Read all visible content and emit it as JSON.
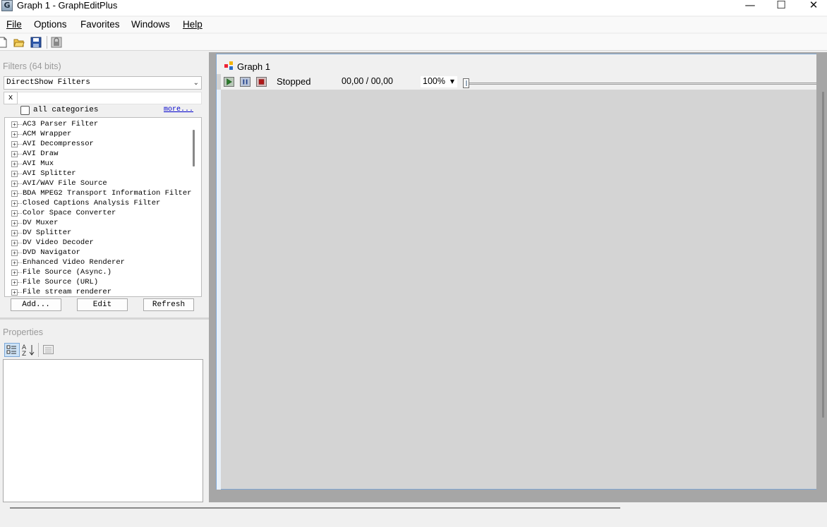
{
  "window": {
    "title": "Graph 1 - GraphEditPlus",
    "app_icon_letter": "G",
    "minimize_glyph": "—",
    "maximize_glyph": "☐",
    "close_glyph": "✕"
  },
  "menu": {
    "file": "File",
    "options": "Options",
    "favorites": "Favorites",
    "windows": "Windows",
    "help": "Help"
  },
  "toolbar": {
    "icons": [
      "new-document-icon",
      "open-folder-icon",
      "save-disk-icon",
      "lock-icon"
    ]
  },
  "filters_panel": {
    "title": "Filters (64 bits)",
    "source_selected": "DirectShow Filters",
    "search_value": "",
    "clear_label": "x",
    "all_categories_label": "all categories",
    "all_categories_checked": false,
    "more_link": "more...",
    "items": [
      "AC3 Parser Filter",
      "ACM Wrapper",
      "AVI Decompressor",
      "AVI Draw",
      "AVI Mux",
      "AVI Splitter",
      "AVI/WAV File Source",
      "BDA MPEG2 Transport Information Filter",
      "Closed Captions Analysis Filter",
      "Color Space Converter",
      "DV Muxer",
      "DV Splitter",
      "DV Video Decoder",
      "DVD Navigator",
      "Enhanced Video Renderer",
      "File Source (Async.)",
      "File Source (URL)",
      "File stream renderer"
    ],
    "add_button": "Add...",
    "edit_button": "Edit",
    "refresh_button": "Refresh"
  },
  "properties_panel": {
    "title": "Properties",
    "icons": [
      "categorized-view-icon",
      "sort-alphabetical-icon",
      "property-pages-icon"
    ]
  },
  "graph_window": {
    "title": "Graph 1",
    "status": "Stopped",
    "time": "00,00 / 00,00",
    "zoom": "100%",
    "seek_position": 0
  },
  "colors": {
    "window_bg": "#f0f0f0",
    "graph_canvas": "#d4d4d4",
    "mdi_bg": "#a6a6a6",
    "link_blue": "#0000cc",
    "graph_border": "#7fa7d4"
  }
}
